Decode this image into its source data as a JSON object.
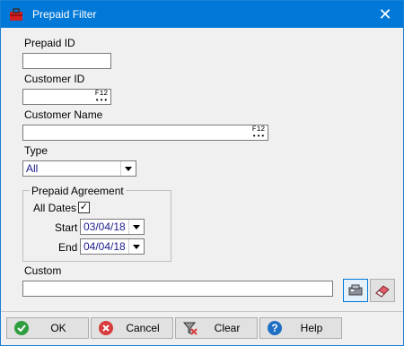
{
  "window": {
    "title": "Prepaid Filter",
    "close_glyph": "✕",
    "app_icon": "red-briefcase-icon"
  },
  "fields": {
    "prepaid_id": {
      "label": "Prepaid ID",
      "value": ""
    },
    "customer_id": {
      "label": "Customer ID",
      "value": "",
      "lookup_key": "F12"
    },
    "customer_name": {
      "label": "Customer Name",
      "value": "",
      "lookup_key": "F12"
    },
    "type": {
      "label": "Type",
      "selected": "All"
    }
  },
  "prepaid_agreement": {
    "legend": "Prepaid Agreement",
    "all_dates": {
      "label": "All Dates",
      "checked": true,
      "check_glyph": "✓"
    },
    "start": {
      "label": "Start",
      "value": "03/04/18"
    },
    "end": {
      "label": "End",
      "value": "04/04/18"
    }
  },
  "custom": {
    "label": "Custom",
    "value": ""
  },
  "buttons": {
    "ok": "OK",
    "cancel": "Cancel",
    "clear": "Clear",
    "help": "Help"
  },
  "colors": {
    "titlebar": "#0078d7",
    "ok": "#2e9e3e",
    "cancel": "#d83b3b",
    "help": "#1f6fc4",
    "select_text": "#1a1a8c"
  }
}
